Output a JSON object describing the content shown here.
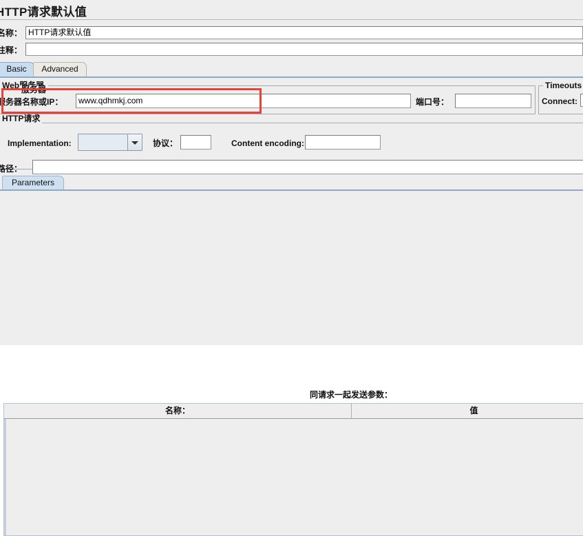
{
  "panel": {
    "title": "HTTP请求默认值"
  },
  "fields": {
    "name_label": "名称：",
    "name_value": "HTTP请求默认值",
    "comment_label": "注释：",
    "comment_value": ""
  },
  "tabs": {
    "basic": "Basic",
    "advanced": "Advanced"
  },
  "web_server": {
    "group_title": "Web服务器",
    "group_title_overlap": "服务器",
    "server_label": "服务器名称或IP：",
    "server_value": "www.qdhmkj.com",
    "port_label": "端口号：",
    "port_value": ""
  },
  "timeouts": {
    "group_title": "Timeouts (",
    "connect_label": "Connect:",
    "connect_value": ""
  },
  "http_request": {
    "group_title": "HTTP请求",
    "implementation_label": "Implementation:",
    "implementation_value": "",
    "protocol_label": "协议：",
    "protocol_value": "",
    "content_encoding_label": "Content encoding:",
    "content_encoding_value": "",
    "path_label": "路径：",
    "path_value": ""
  },
  "parameters": {
    "tab_label": "Parameters",
    "heading": "同请求一起发送参数：",
    "columns": [
      "名称：",
      "值"
    ],
    "rows": []
  },
  "colors": {
    "highlight": "#e8413a",
    "tab_selected": "#c9ddf0",
    "panel_bg": "#eeeeee"
  }
}
